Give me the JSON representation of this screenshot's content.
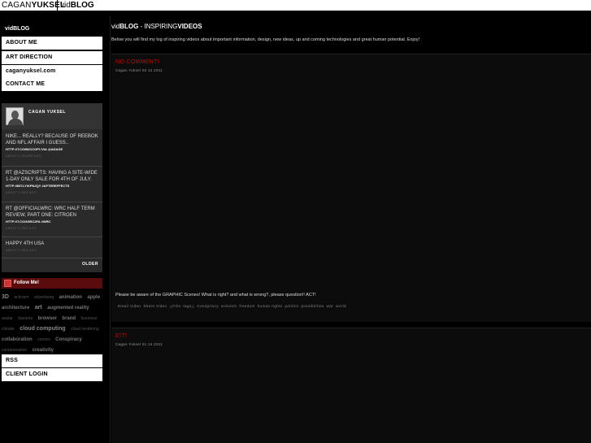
{
  "header": {
    "brand_light": "CAGAN",
    "brand_bold": "YUKSEL",
    "site_light": "vid",
    "site_bold": "BLOG"
  },
  "sidebar": {
    "title": "vidBLOG",
    "nav": [
      "ABOUT ME",
      "ART DIRECTION",
      "caganyuksel.com",
      "CONTACT ME"
    ],
    "twitter": {
      "name": "CAGAN YUKSEL",
      "tweets": [
        {
          "text": "NIKE... REALLY? BECAUSE OF REEBOK AND NFL AFFAIR I GUESS..",
          "links": "HTTP://T.CO/B2CCOPI /VIA @ADAGE",
          "time": "ABOUT 2 HOURS AGO"
        },
        {
          "text": "RT @AZSCRIPTS: HAVING A SITE-WIDE 1-DAY ONLY SALE FOR 4TH OF JULY.",
          "links": "HTTP://BIT.LY/KPNJQY #AFTEREFFECTS",
          "time": "ABOUT 3 HRS AGO"
        },
        {
          "text": "RT @OFFICIALWRC: WRC HALF TERM REVIEW, PART ONE: CITROEN",
          "links": "HTTP://T.CO/3GRC2FA #WRC",
          "time": "ABOUT 3 HRS AGO"
        },
        {
          "text": "HAPPY 4TH USA",
          "links": "",
          "time": "ABOUT 3 HRS AGO"
        }
      ],
      "older": "OLDER"
    },
    "follow": "Follow Me!",
    "tags": [
      {
        "t": "3D",
        "s": 7,
        "c": "#888"
      },
      {
        "t": "activism",
        "s": 5,
        "c": "#555"
      },
      {
        "t": "advertising",
        "s": 5,
        "c": "#555"
      },
      {
        "t": "animation",
        "s": 6,
        "c": "#777"
      },
      {
        "t": "apple",
        "s": 6,
        "c": "#777"
      },
      {
        "t": "architecture",
        "s": 6,
        "c": "#777"
      },
      {
        "t": "art",
        "s": 7,
        "c": "#888"
      },
      {
        "t": "augmented reality",
        "s": 6,
        "c": "#777"
      },
      {
        "t": "avatar",
        "s": 5,
        "c": "#555"
      },
      {
        "t": "bacteria",
        "s": 5,
        "c": "#555"
      },
      {
        "t": "browser",
        "s": 6,
        "c": "#777"
      },
      {
        "t": "brand",
        "s": 6,
        "c": "#777"
      },
      {
        "t": "business",
        "s": 5,
        "c": "#555"
      },
      {
        "t": "climate",
        "s": 5,
        "c": "#555"
      },
      {
        "t": "cloud computing",
        "s": 7,
        "c": "#888"
      },
      {
        "t": "cloud rendering",
        "s": 5,
        "c": "#555"
      },
      {
        "t": "collaboration",
        "s": 6,
        "c": "#777"
      },
      {
        "t": "comics",
        "s": 5,
        "c": "#555"
      },
      {
        "t": "Conspiracy",
        "s": 6,
        "c": "#777"
      },
      {
        "t": "contamination",
        "s": 5,
        "c": "#555"
      },
      {
        "t": "creativity",
        "s": 6,
        "c": "#777"
      }
    ],
    "bottom_nav": [
      "RSS",
      "CLIENT LOGIN"
    ]
  },
  "main": {
    "title_light": "vid",
    "title_bold": "BLOG",
    "title_sep": " - INSPIRING",
    "title_bold2": "VIDEOS",
    "intro": "Below you will find my log of inspiring videos about important information, design, new ideas, up and coming technologies and great human potential. Enjoy!",
    "posts": [
      {
        "title": "NO COMMENT!",
        "meta": "Cagan Yuksel 02.12.2011",
        "body": "Please be aware of the GRAPHIC Scenes! What is right? and what is wrong?, please question!! ACT!",
        "tags": [
          "Email Video",
          "Share Video",
          "△Film",
          "tags△",
          "Conspiracy",
          "activism",
          "freedom",
          "human rights",
          "politics",
          "possibilities",
          "war",
          "world"
        ]
      },
      {
        "title": "EİT!",
        "meta": "Cagan Yuksel 01.14.2011",
        "body": "",
        "tags": []
      }
    ]
  }
}
